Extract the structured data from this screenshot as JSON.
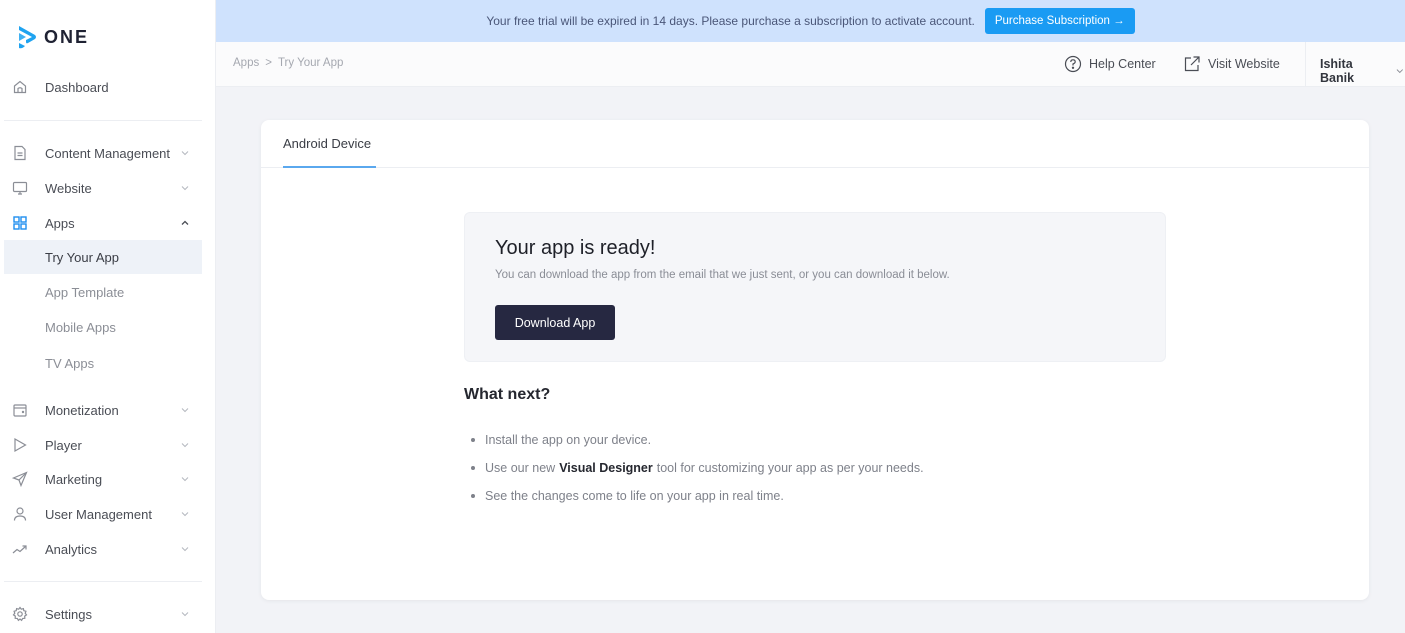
{
  "brand": {
    "name": "ONE",
    "color": "#1fa3f0"
  },
  "banner": {
    "text": "Your free trial will be expired in 14 days. Please purchase a subscription to activate account.",
    "button_label": "Purchase Subscription →"
  },
  "breadcrumb": {
    "items": [
      "Apps",
      "Try Your App"
    ],
    "separator": ">"
  },
  "topbar": {
    "help_label": "Help Center",
    "visit_label": "Visit Website",
    "user_name": "Ishita Banik"
  },
  "sidebar": {
    "dashboard": "Dashboard",
    "items": [
      {
        "label": "Content Management",
        "icon": "document-icon",
        "expanded": false
      },
      {
        "label": "Website",
        "icon": "monitor-icon",
        "expanded": false
      },
      {
        "label": "Apps",
        "icon": "grid-icon",
        "expanded": true
      },
      {
        "label": "Monetization",
        "icon": "wallet-icon",
        "expanded": false
      },
      {
        "label": "Player",
        "icon": "play-icon",
        "expanded": false
      },
      {
        "label": "Marketing",
        "icon": "send-icon",
        "expanded": false
      },
      {
        "label": "User Management",
        "icon": "user-icon",
        "expanded": false
      },
      {
        "label": "Analytics",
        "icon": "trend-icon",
        "expanded": false
      }
    ],
    "apps_sub": [
      "Try Your App",
      "App Template",
      "Mobile Apps",
      "TV Apps"
    ],
    "active_sub": "Try Your App",
    "settings": "Settings"
  },
  "main": {
    "tab": "Android Device",
    "ready_title": "Your app is ready!",
    "ready_desc": "You can download the app from the email that we just sent, or you can download it below.",
    "download_label": "Download App",
    "next_title": "What next?",
    "next_items": [
      {
        "pre": "Install the app on your device.",
        "bold": "",
        "post": ""
      },
      {
        "pre": "Use our new",
        "bold": "Visual Designer",
        "post": "tool for customizing your app as per your needs."
      },
      {
        "pre": "See the changes come to life on your app in real time.",
        "bold": "",
        "post": ""
      }
    ]
  }
}
